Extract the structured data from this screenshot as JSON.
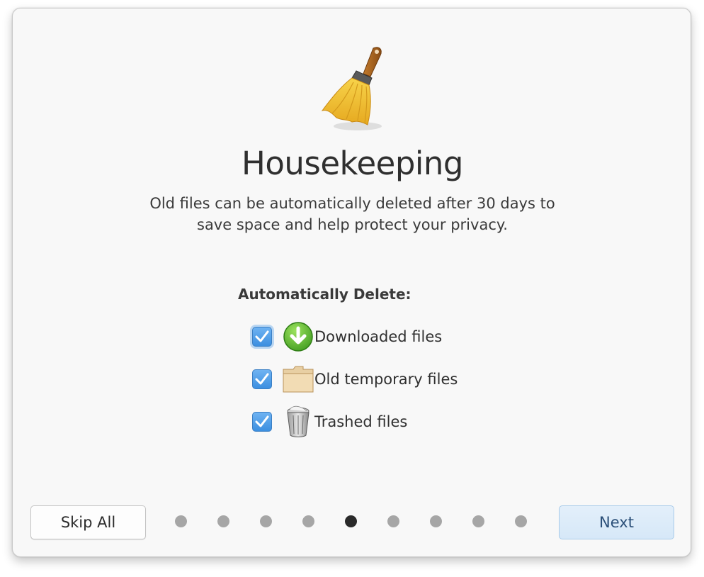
{
  "hero": {
    "icon": "broom-icon"
  },
  "title": "Housekeeping",
  "description": "Old files can be automatically deleted after 30 days to save space and help protect your privacy.",
  "options": {
    "heading": "Automatically Delete:",
    "items": [
      {
        "label": "Downloaded files",
        "checked": true,
        "icon": "download-arrow-icon"
      },
      {
        "label": "Old temporary files",
        "checked": true,
        "icon": "folder-icon"
      },
      {
        "label": "Trashed files",
        "checked": true,
        "icon": "trash-can-icon"
      }
    ]
  },
  "footer": {
    "skip_label": "Skip All",
    "next_label": "Next",
    "pager": {
      "total": 9,
      "current": 5
    }
  },
  "colors": {
    "checkbox": "#4a98e6",
    "next_button_bg": "#d9eaf9",
    "active_dot": "#2a2a2a",
    "inactive_dot": "#a6a6a6"
  }
}
